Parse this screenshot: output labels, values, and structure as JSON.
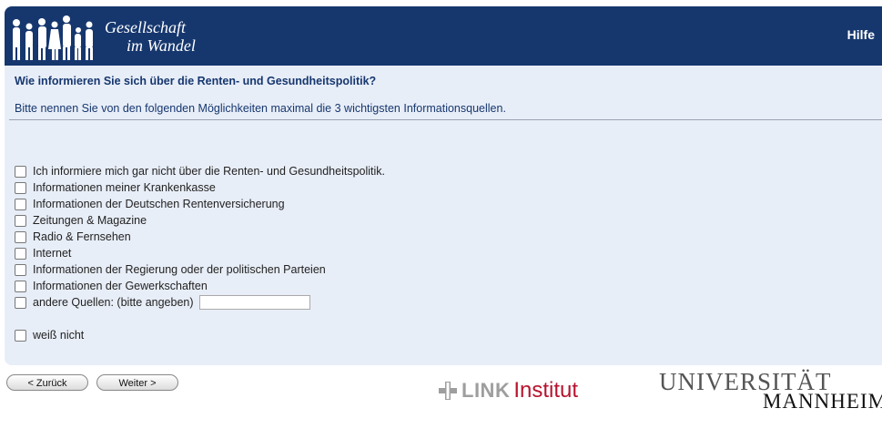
{
  "header": {
    "logo_line1": "Gesellschaft",
    "logo_line2": "im Wandel",
    "help_label": "Hilfe"
  },
  "question": {
    "title": "Wie informieren Sie sich über die Renten- und Gesundheitspolitik?",
    "instruction": "Bitte nennen Sie von den folgenden Möglichkeiten maximal die 3 wichtigsten Informationsquellen."
  },
  "options": [
    {
      "label": "Ich informiere mich gar nicht über die Renten- und Gesundheitspolitik.",
      "checked": false
    },
    {
      "label": "Informationen meiner Krankenkasse",
      "checked": false
    },
    {
      "label": "Informationen der Deutschen Rentenversicherung",
      "checked": false
    },
    {
      "label": "Zeitungen & Magazine",
      "checked": false
    },
    {
      "label": "Radio & Fernsehen",
      "checked": false
    },
    {
      "label": "Internet",
      "checked": false
    },
    {
      "label": "Informationen der Regierung oder der politischen Parteien",
      "checked": false
    },
    {
      "label": "Informationen der Gewerkschaften",
      "checked": false
    },
    {
      "label": "andere Quellen: (bitte angeben)",
      "checked": false,
      "input_value": ""
    },
    {
      "label": "weiß nicht",
      "checked": false
    }
  ],
  "nav": {
    "back_label": "< Zurück",
    "next_label": "Weiter >"
  },
  "footer": {
    "link_word": "LINK",
    "link_suffix": "Institut",
    "uni_line1": "UNIVERSITÄT",
    "uni_line2": "MANNHEIM"
  },
  "colors": {
    "header_bg": "#16376e",
    "panel_bg": "#e8eef8",
    "link_red": "#b7132e"
  }
}
